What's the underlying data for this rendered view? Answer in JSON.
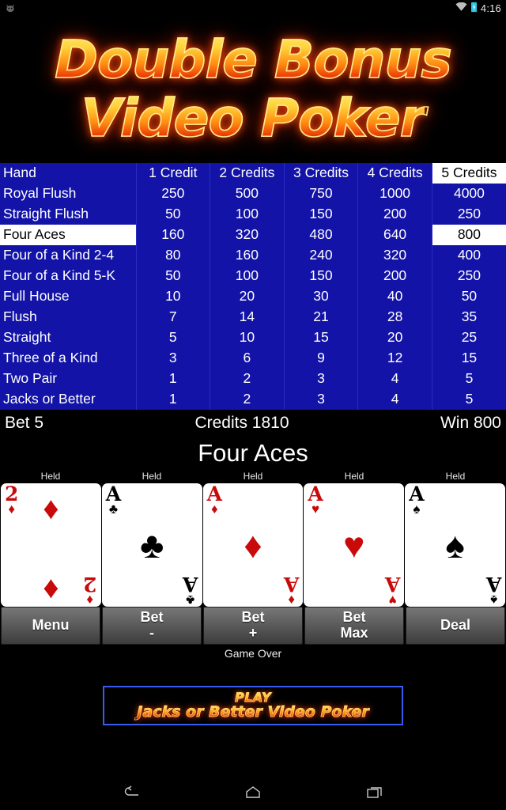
{
  "statusbar": {
    "app_icon": "android-app-icon",
    "wifi_icon": "wifi-icon",
    "battery_icon": "battery-charging-icon",
    "clock": "4:16"
  },
  "title": {
    "line1": "Double Bonus",
    "line2": "Video Poker"
  },
  "paytable": {
    "columns": [
      "Hand",
      "1 Credit",
      "2 Credits",
      "3 Credits",
      "4 Credits",
      "5 Credits"
    ],
    "highlight_column": "5 Credits",
    "highlight_row": "Four Aces",
    "rows": [
      {
        "hand": "Royal Flush",
        "values": [
          "250",
          "500",
          "750",
          "1000",
          "4000"
        ]
      },
      {
        "hand": "Straight Flush",
        "values": [
          "50",
          "100",
          "150",
          "200",
          "250"
        ]
      },
      {
        "hand": "Four Aces",
        "values": [
          "160",
          "320",
          "480",
          "640",
          "800"
        ]
      },
      {
        "hand": "Four of a Kind 2-4",
        "values": [
          "80",
          "160",
          "240",
          "320",
          "400"
        ]
      },
      {
        "hand": "Four of a Kind 5-K",
        "values": [
          "50",
          "100",
          "150",
          "200",
          "250"
        ]
      },
      {
        "hand": "Full House",
        "values": [
          "10",
          "20",
          "30",
          "40",
          "50"
        ]
      },
      {
        "hand": "Flush",
        "values": [
          "7",
          "14",
          "21",
          "28",
          "35"
        ]
      },
      {
        "hand": "Straight",
        "values": [
          "5",
          "10",
          "15",
          "20",
          "25"
        ]
      },
      {
        "hand": "Three of a Kind",
        "values": [
          "3",
          "6",
          "9",
          "12",
          "15"
        ]
      },
      {
        "hand": "Two Pair",
        "values": [
          "1",
          "2",
          "3",
          "4",
          "5"
        ]
      },
      {
        "hand": "Jacks or Better",
        "values": [
          "1",
          "2",
          "3",
          "4",
          "5"
        ]
      }
    ]
  },
  "meters": {
    "bet": "Bet 5",
    "credits": "Credits 1810",
    "win": "Win 800"
  },
  "result": "Four Aces",
  "cards": [
    {
      "held_label": "Held",
      "rank": "2",
      "suit": "♦",
      "color": "red",
      "pips": "two"
    },
    {
      "held_label": "Held",
      "rank": "A",
      "suit": "♣",
      "color": "black",
      "pips": "one"
    },
    {
      "held_label": "Held",
      "rank": "A",
      "suit": "♦",
      "color": "red",
      "pips": "one"
    },
    {
      "held_label": "Held",
      "rank": "A",
      "suit": "♥",
      "color": "red",
      "pips": "one"
    },
    {
      "held_label": "Held",
      "rank": "A",
      "suit": "♠",
      "color": "black",
      "pips": "one"
    }
  ],
  "buttons": [
    {
      "line1": "Menu",
      "line2": ""
    },
    {
      "line1": "Bet",
      "line2": "-"
    },
    {
      "line1": "Bet",
      "line2": "+"
    },
    {
      "line1": "Bet",
      "line2": "Max"
    },
    {
      "line1": "Deal",
      "line2": ""
    }
  ],
  "status_text": "Game Over",
  "ad": {
    "line1": "PLAY",
    "line2": "Jacks or Better Video Poker",
    "border_color": "#3a5bf0"
  },
  "navbar": {
    "back_icon": "back-arrow-icon",
    "home_icon": "home-icon",
    "recents_icon": "recent-apps-icon"
  },
  "colors": {
    "table_blue": "#1313a8",
    "highlight_white": "#ffffff",
    "card_red": "#c80a0a",
    "accent_orange": "#ff6a0c"
  }
}
